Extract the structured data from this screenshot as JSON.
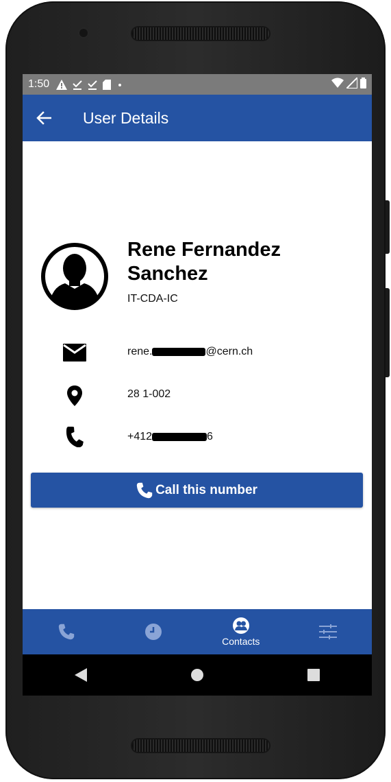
{
  "status_bar": {
    "time": "1:50",
    "icons": [
      "warning-icon",
      "download-done-icon",
      "download-done-icon",
      "sd-card-icon",
      "dot-icon"
    ],
    "right_icons": [
      "wifi-icon",
      "signal-icon",
      "battery-icon"
    ]
  },
  "app_bar": {
    "title": "User Details",
    "back_icon": "arrow-back-icon"
  },
  "user": {
    "name": "Rene Fernandez Sanchez",
    "department": "IT-CDA-IC",
    "email_prefix": "rene.",
    "email_suffix": "@cern.ch",
    "office": "28 1-002",
    "phone_prefix": "+412",
    "phone_suffix": "6"
  },
  "call_button": {
    "label": "Call this number"
  },
  "bottom_nav": {
    "items": [
      {
        "icon": "phone-icon",
        "label": ""
      },
      {
        "icon": "history-icon",
        "label": ""
      },
      {
        "icon": "contacts-icon",
        "label": "Contacts"
      },
      {
        "icon": "settings-sliders-icon",
        "label": ""
      }
    ],
    "active_index": 2
  },
  "colors": {
    "primary": "#2553a3",
    "nav_inactive": "#8aa4d6",
    "status_bar": "#7b7b7b"
  }
}
